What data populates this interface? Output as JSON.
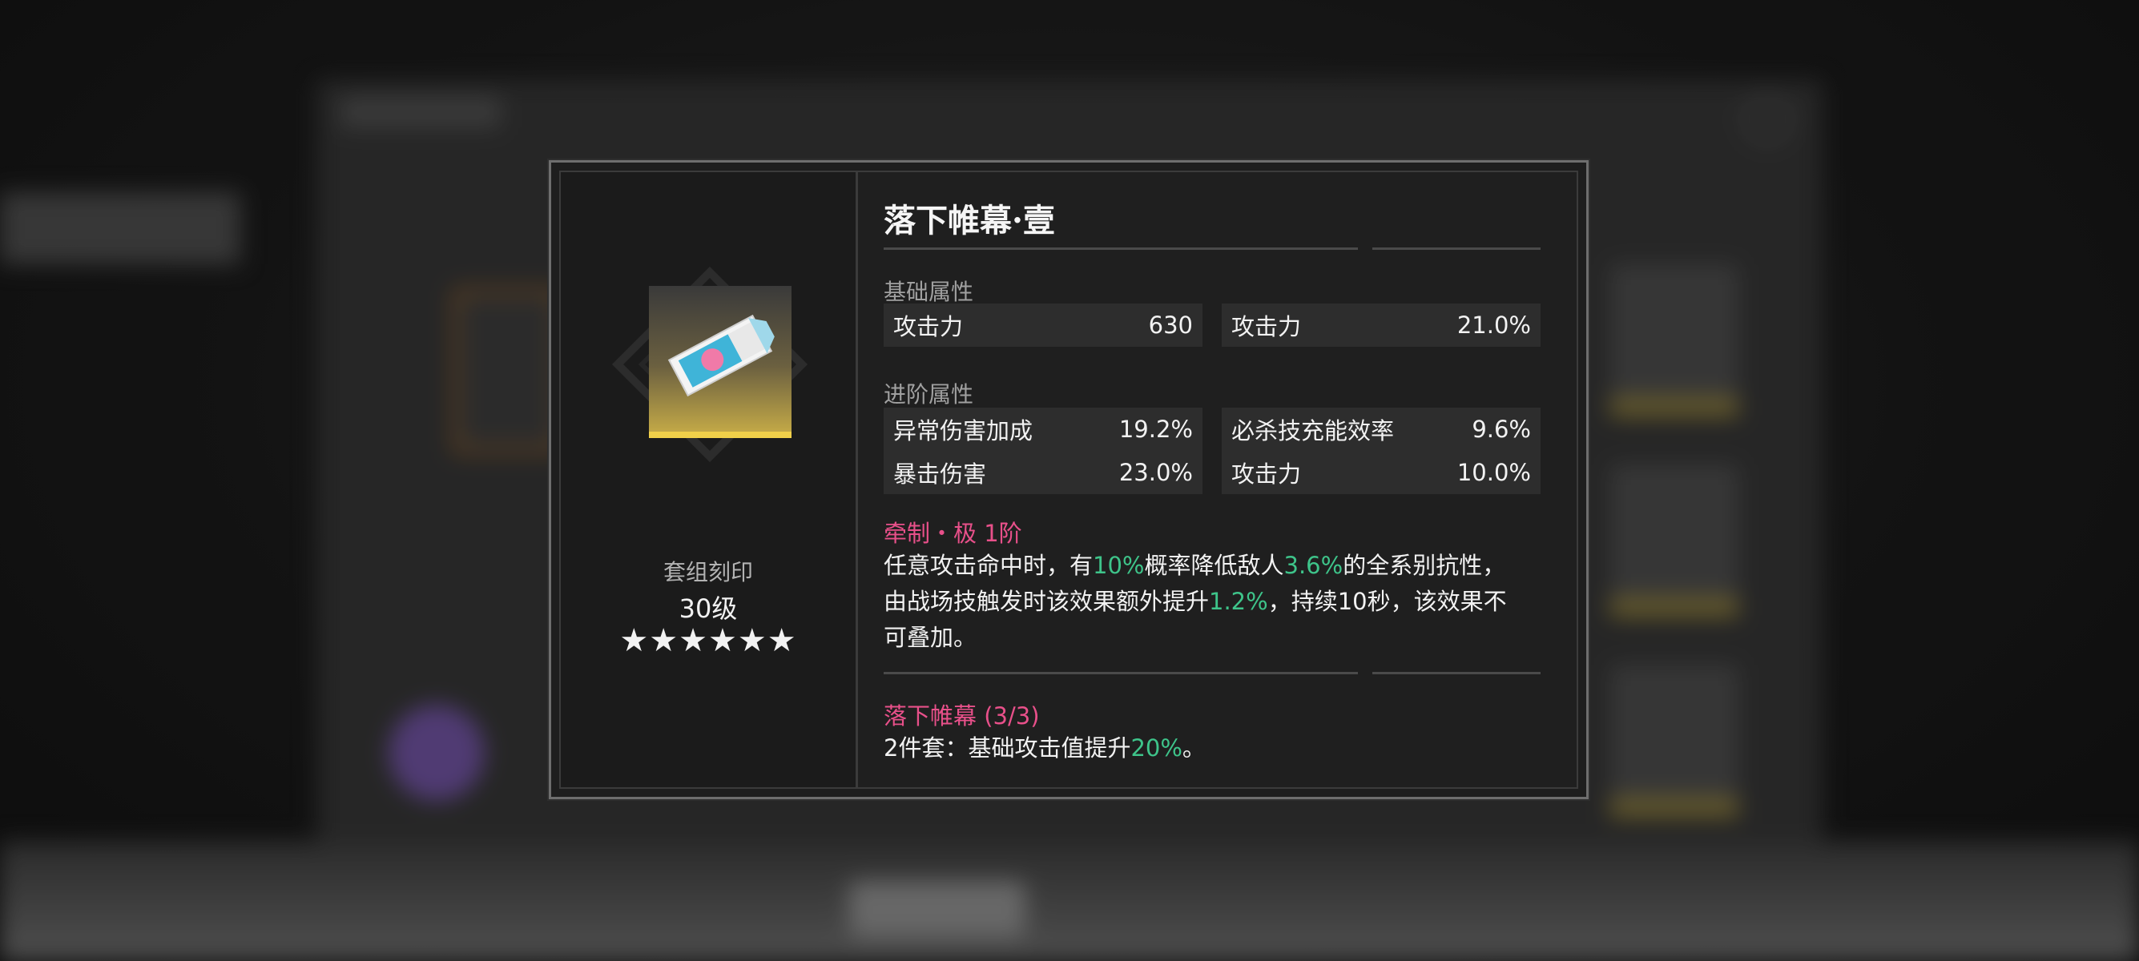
{
  "item": {
    "title": "落下帷幕·壹",
    "icon": "tape-disc-icon",
    "set_label": "套组刻印",
    "level": "30级",
    "stars": "★★★★★★",
    "star_count": 6
  },
  "base_attributes": {
    "label": "基础属性",
    "stats": [
      {
        "name": "攻击力",
        "value": "630"
      },
      {
        "name": "攻击力",
        "value": "21.0%"
      }
    ]
  },
  "advanced_attributes": {
    "label": "进阶属性",
    "stats": [
      {
        "name": "异常伤害加成",
        "value": "19.2%"
      },
      {
        "name": "必杀技充能效率",
        "value": "9.6%"
      },
      {
        "name": "暴击伤害",
        "value": "23.0%"
      },
      {
        "name": "攻击力",
        "value": "10.0%"
      }
    ]
  },
  "skill": {
    "name": "牵制・极 1阶",
    "line1": {
      "a": "任意攻击命中时，有",
      "b": "10%",
      "c": "概率降低敌人",
      "d": "3.6%",
      "e": "的全系别抗性，"
    },
    "line2": {
      "a": "由战场技触发时该效果额外提升",
      "b": "1.2%",
      "c": "，持续10秒，该效果不"
    },
    "line3": "可叠加。"
  },
  "set_bonus": {
    "name": "落下帷幕 (3/3)",
    "text_a": "2件套：基础攻击值提升",
    "text_b": "20%",
    "text_c": "。"
  },
  "colors": {
    "accent_pink": "#e8508a",
    "value_green": "#3ec48a",
    "rarity_gold": "#f0d04a"
  }
}
